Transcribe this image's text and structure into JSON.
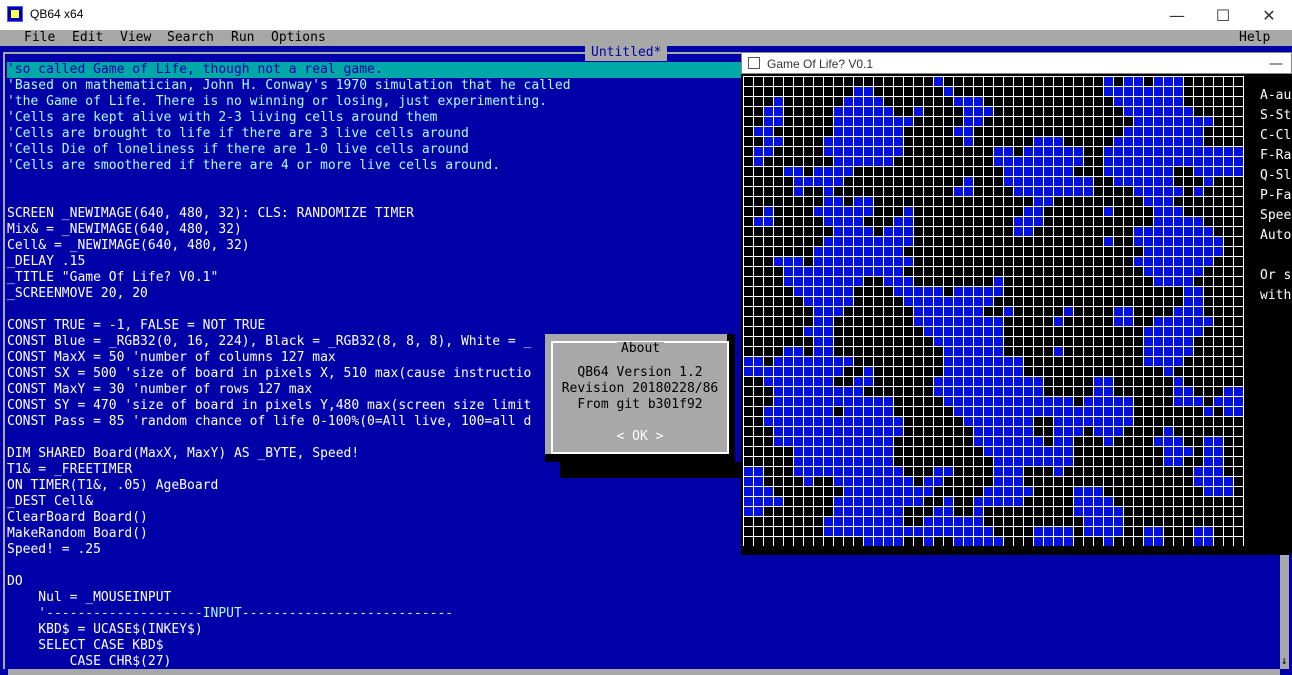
{
  "window": {
    "title": "QB64 x64"
  },
  "menu": {
    "file": "File",
    "edit": "Edit",
    "view": "View",
    "search": "Search",
    "run": "Run",
    "options": "Options",
    "help": "Help"
  },
  "editor": {
    "document_title": "Untitled*",
    "lines": [
      {
        "t": "'so called Game of Life, though not a real game.",
        "c": "sel"
      },
      {
        "t": "'Based on mathematician, John H. Conway's 1970 simulation that he called",
        "c": "c-cmt"
      },
      {
        "t": "'the Game of Life. There is no winning or losing, just experimenting.",
        "c": "c-cmt"
      },
      {
        "t": "'Cells are kept alive with 2-3 living cells around them",
        "c": "c-cmt"
      },
      {
        "t": "'Cells are brought to life if there are 3 live cells around",
        "c": "c-cmt"
      },
      {
        "t": "'Cells Die of loneliness if there are 1-0 live cells around",
        "c": "c-cmt"
      },
      {
        "t": "'Cells are smoothered if there are 4 or more live cells around.",
        "c": "c-cmt"
      },
      {
        "t": "",
        "c": ""
      },
      {
        "t": "",
        "c": ""
      },
      {
        "t": "SCREEN _NEWIMAGE(640, 480, 32): CLS: RANDOMIZE TIMER",
        "c": "c-kw"
      },
      {
        "t": "Mix& = _NEWIMAGE(640, 480, 32)",
        "c": "c-kw"
      },
      {
        "t": "Cell& = _NEWIMAGE(640, 480, 32)",
        "c": "c-kw"
      },
      {
        "t": "_DELAY .15",
        "c": "c-kw"
      },
      {
        "t": "_TITLE \"Game Of Life? V0.1\"",
        "c": "c-kw"
      },
      {
        "t": "_SCREENMOVE 20, 20",
        "c": "c-kw"
      },
      {
        "t": "",
        "c": ""
      },
      {
        "t": "CONST TRUE = -1, FALSE = NOT TRUE",
        "c": "c-kw"
      },
      {
        "t": "CONST Blue = _RGB32(0, 16, 224), Black = _RGB32(8, 8, 8), White = _",
        "c": "c-kw"
      },
      {
        "t": "CONST MaxX = 50 'number of columns 127 max",
        "c": "c-kw"
      },
      {
        "t": "CONST SX = 500 'size of board in pixels X, 510 max(cause instructio",
        "c": "c-kw"
      },
      {
        "t": "CONST MaxY = 30 'number of rows 127 max",
        "c": "c-kw"
      },
      {
        "t": "CONST SY = 470 'size of board in pixels Y,480 max(screen size limit",
        "c": "c-kw"
      },
      {
        "t": "CONST Pass = 85 'random chance of life 0-100%(0=All live, 100=all d",
        "c": "c-kw"
      },
      {
        "t": "",
        "c": ""
      },
      {
        "t": "DIM SHARED Board(MaxX, MaxY) AS _BYTE, Speed!",
        "c": "c-kw"
      },
      {
        "t": "T1& = _FREETIMER",
        "c": "c-kw"
      },
      {
        "t": "ON TIMER(T1&, .05) AgeBoard",
        "c": "c-kw"
      },
      {
        "t": "_DEST Cell&",
        "c": "c-kw"
      },
      {
        "t": "ClearBoard Board()",
        "c": "c-kw"
      },
      {
        "t": "MakeRandom Board()",
        "c": "c-kw"
      },
      {
        "t": "Speed! = .25",
        "c": "c-kw"
      },
      {
        "t": "",
        "c": ""
      },
      {
        "t": "DO",
        "c": "c-kw"
      },
      {
        "t": "    Nul = _MOUSEINPUT",
        "c": "c-kw"
      },
      {
        "t": "    '--------------------INPUT---------------------------",
        "c": "c-cmt"
      },
      {
        "t": "    KBD$ = UCASE$(INKEY$)",
        "c": "c-kw"
      },
      {
        "t": "    SELECT CASE KBD$",
        "c": "c-kw"
      },
      {
        "t": "        CASE CHR$(27)",
        "c": "c-kw"
      }
    ]
  },
  "about": {
    "title": "About",
    "version": "QB64 Version 1.2",
    "revision": "Revision 20180228/86",
    "git": "From git b301f92",
    "ok": "< OK >"
  },
  "game_window": {
    "title": "Game Of Life? V0.1",
    "side_text": [
      "A-au",
      "S-St",
      "C-Cl",
      "F-Ra",
      "Q-Sl",
      "P-Fa",
      "Spee",
      "Auto",
      "",
      "Or s",
      "with"
    ],
    "cols": 50,
    "rows": 47,
    "colors": {
      "live": "#0010e0",
      "grid": "#ffffff",
      "dead": "#000000"
    }
  }
}
